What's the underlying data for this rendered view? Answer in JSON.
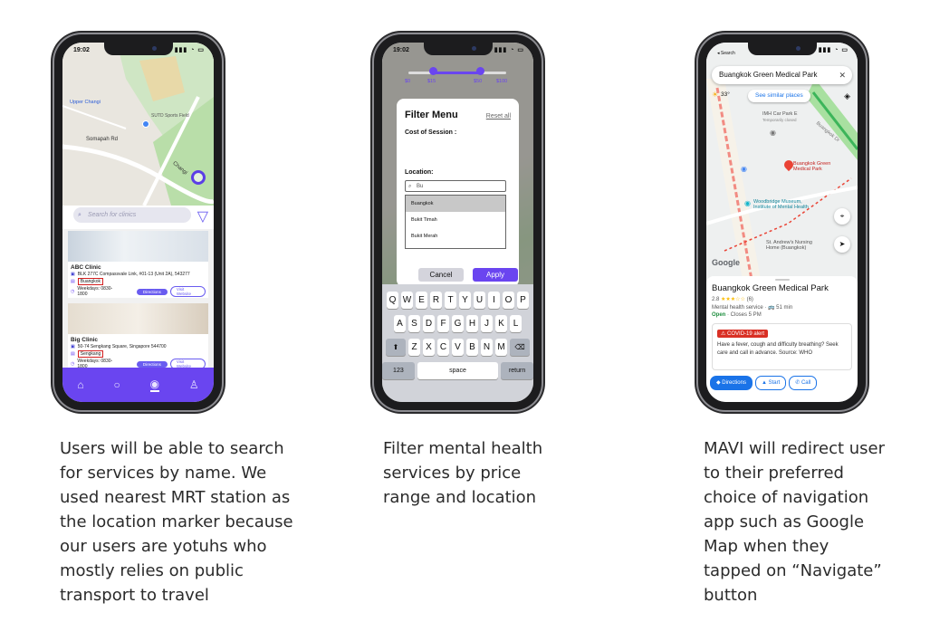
{
  "phone1": {
    "time": "19:02",
    "map_labels": {
      "upper_changi": "Upper Changi",
      "sports_field": "SUTD Sports Field",
      "somapah": "Somapah Rd",
      "changi": "Changi"
    },
    "search_placeholder": "Search for clinics",
    "clinics": [
      {
        "name": "ABC Clinic",
        "address": "BLK 277C Compassvale Link, #01-13 (Unit 2A), 543277",
        "station": "Buangkok",
        "hours": "Weekdays: 0830-1800",
        "directions": "Directions",
        "website": "Visit Website"
      },
      {
        "name": "Big Clinic",
        "address": "50-74 Sengkang Square, Singapore 544700",
        "station": "Sengkang",
        "hours": "Weekdays: 0830-1800",
        "directions": "Directions",
        "website": "Visit Website"
      }
    ],
    "caption": "Users will be able to search\nfor services by name. We\nused nearest MRT station as\nthe location marker because\nour users are yotuhs who\nmostly relies on public\ntransport to travel"
  },
  "phone2": {
    "time": "19:02",
    "filter_title": "Filter Menu",
    "reset": "Reset all",
    "cost_label": "Cost of Session :",
    "ticks": [
      "$0",
      "$15",
      "$50",
      "$100"
    ],
    "location_label": "Location:",
    "location_value": "Bu",
    "options": [
      "Buangkok",
      "Bukit Timah",
      "Bukit Merah"
    ],
    "cancel": "Cancel",
    "apply": "Apply",
    "row1": [
      "Q",
      "W",
      "E",
      "R",
      "T",
      "Y",
      "U",
      "I",
      "O",
      "P"
    ],
    "row2": [
      "A",
      "S",
      "D",
      "F",
      "G",
      "H",
      "J",
      "K",
      "L"
    ],
    "row3": [
      "Z",
      "X",
      "C",
      "V",
      "B",
      "N",
      "M"
    ],
    "num_key": "123",
    "space_key": "space",
    "return_key": "return",
    "caption": "Filter mental health\nservices by price\nrange and location"
  },
  "phone3": {
    "back": "◂ Search",
    "search_value": "Buangkok Green Medical Park",
    "similar": "See similar places",
    "temperature": "33°",
    "map_labels": {
      "imh": "IMH Car Park E",
      "imh_sub": "Temporarily closed",
      "pin": "Buangkok Green\nMedical Park",
      "woodbridge": "Woodbridge Museum,\nInstitute of Mental Health",
      "st_andrew": "St. Andrew's Nursing\nHome (Buangkok)",
      "buangkok_dr": "Buangkok Dr",
      "google": "Google"
    },
    "place_name": "Buangkok Green Medical Park",
    "rating": "2.8",
    "stars": "★★★☆☆",
    "reviews": "(6)",
    "type": "Mental health service · 🚌 51 min",
    "open": "Open",
    "closes": " · Closes 5 PM",
    "alert_badge": "⚠ COVID-19 alert",
    "alert_text": "Have a fever, cough and difficulty breathing? Seek care and call in advance. Source: WHO",
    "btn_directions": "Directions",
    "btn_start": "Start",
    "btn_call": "Call",
    "caption": "MAVI will redirect user\nto their preferred\nchoice of navigation\napp such as Google\nMap when they\ntapped on “Navigate”\nbutton"
  }
}
